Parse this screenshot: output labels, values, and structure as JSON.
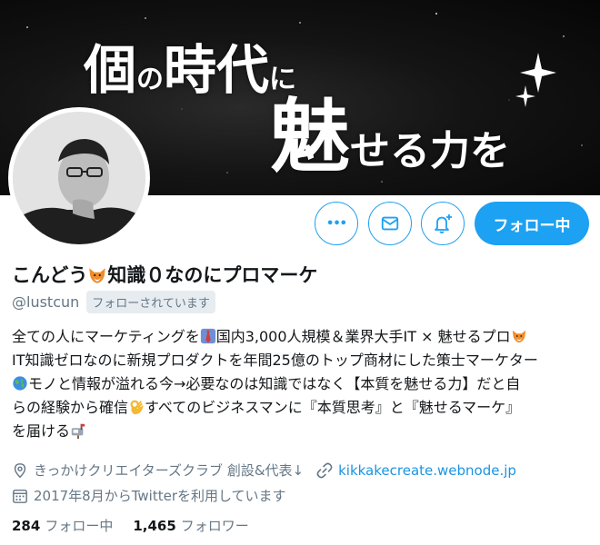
{
  "banner": {
    "part1": "個",
    "part2": "の",
    "part3": "時代",
    "part4": "に",
    "part5": "魅",
    "part6": "せる力を"
  },
  "actions": {
    "more_label": "•••",
    "follow_button": "フォロー中"
  },
  "profile": {
    "name": "こんどう",
    "name_emoji": "fox-emoji",
    "name_rest": "知識０なのにプロマーケ",
    "handle": "@lustcun",
    "follows_you": "フォローされています"
  },
  "bio": {
    "l1a": "全ての人にマーケティングを",
    "l1b": "国内3,000人規模＆業界大手IT × 魅せるプロ",
    "l2": "IT知識ゼロなのに新規プロダクトを年間25億のトップ商材にした策士マーケター",
    "l3": "モノと情報が溢れる今→必要なのは知識ではなく【本質を魅せる力】だと自",
    "l4a": "らの経験から確信",
    "l4b": "すべてのビジネスマンに『本質思考』と『魅せるマーケ』",
    "l5": "を届ける"
  },
  "meta": {
    "location": "きっかけクリエイターズクラブ 創設&代表↓",
    "website": "kikkakecreate.webnode.jp",
    "joined": "2017年8月からTwitterを利用しています"
  },
  "stats": {
    "following_count": "284",
    "following_label": "フォロー中",
    "followers_count": "1,465",
    "followers_label": "フォロワー"
  },
  "colors": {
    "accent": "#1da1f2",
    "link": "#1b95e0",
    "muted": "#657786"
  }
}
